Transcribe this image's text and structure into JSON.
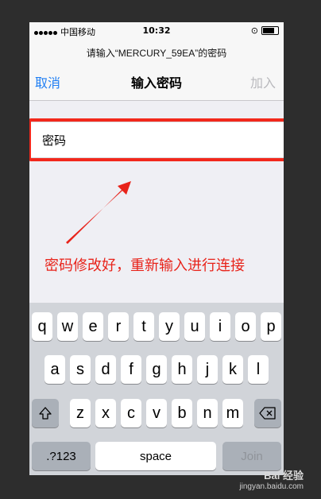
{
  "status_bar": {
    "carrier": "中国移动",
    "time": "10:32"
  },
  "nav": {
    "prompt": "请输入“MERCURY_59EA”的密码",
    "title": "输入密码",
    "cancel_label": "取消",
    "join_label": "加入"
  },
  "password_field": {
    "placeholder": "密码",
    "value": ""
  },
  "annotation": {
    "text": "密码修改好，重新输入进行连接",
    "color": "#e8231a"
  },
  "keyboard": {
    "row1": [
      "q",
      "w",
      "e",
      "r",
      "t",
      "y",
      "u",
      "i",
      "o",
      "p"
    ],
    "row2": [
      "a",
      "s",
      "d",
      "f",
      "g",
      "h",
      "j",
      "k",
      "l"
    ],
    "row3": [
      "z",
      "x",
      "c",
      "v",
      "b",
      "n",
      "m"
    ],
    "shift_icon": "shift-arrow-icon",
    "delete_icon": "backspace-icon",
    "numbers_label": ".?123",
    "space_label": "space",
    "join_label": "Join"
  },
  "watermark": {
    "logo": "Bai 经验",
    "url": "jingyan.baidu.com"
  },
  "colors": {
    "accent": "#1f7ef3",
    "highlight": "#f2281c",
    "keyboard_bg": "#d1d4d9"
  }
}
